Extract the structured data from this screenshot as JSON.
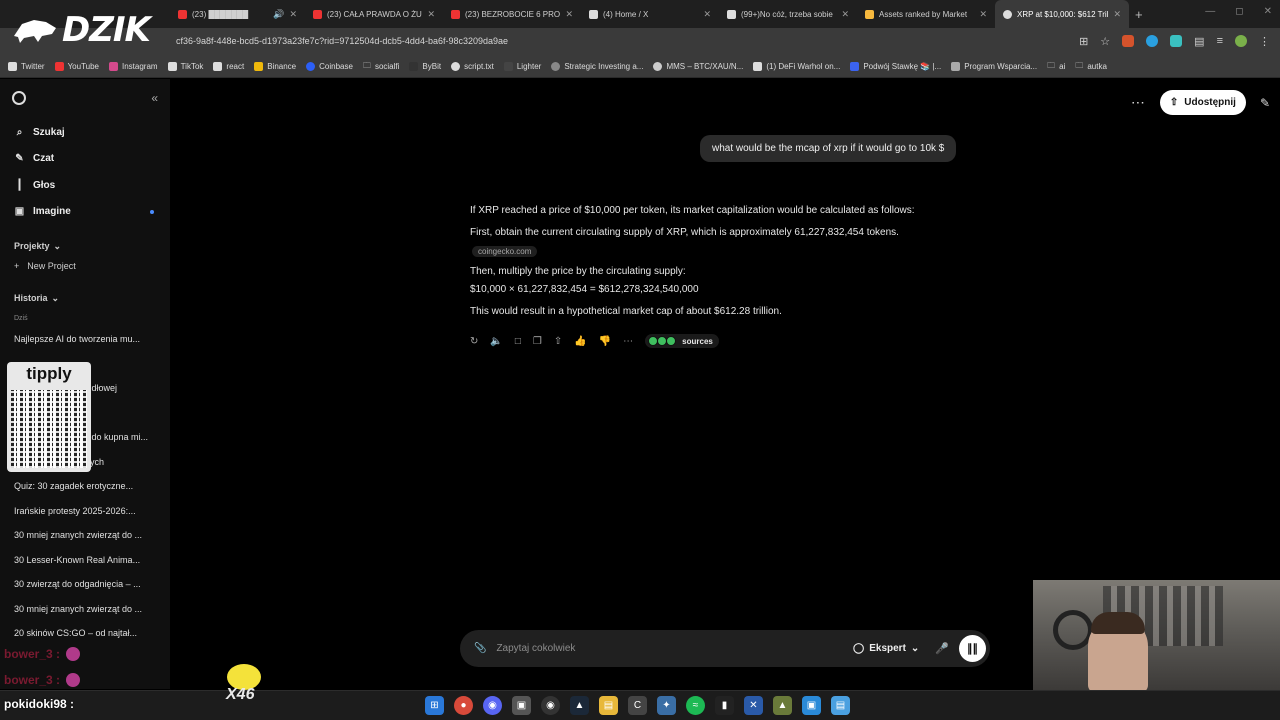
{
  "browser": {
    "tabs": [
      {
        "title": "(23) ███████",
        "color": "#e33"
      },
      {
        "title": "(23) CAŁA PRAWDA O ŻU",
        "color": "#e33"
      },
      {
        "title": "(23) BEZROBOCIE 6 PROC",
        "color": "#e33"
      },
      {
        "title": "(4) Home / X",
        "color": "#ddd"
      },
      {
        "title": "(99+)No cóż, trzeba sobie",
        "color": "#ddd"
      },
      {
        "title": "Assets ranked by Market",
        "color": "#f7b93e"
      },
      {
        "title": "XRP at $10,000: $612 Trilli",
        "color": "#ddd"
      }
    ],
    "url": "cf36-9a8f-448e-bcd5-d1973a23fe7c?rid=9712504d-dcb5-4dd4-ba6f-98c3209da9ae",
    "bookmarks": [
      {
        "label": "Twitter",
        "color": "#ddd"
      },
      {
        "label": "YouTube",
        "color": "#e33"
      },
      {
        "label": "Instagram",
        "color": "#d44a8c"
      },
      {
        "label": "TikTok",
        "color": "#ddd"
      },
      {
        "label": "react",
        "color": "#ddd"
      },
      {
        "label": "Binance",
        "color": "#f0b90b"
      },
      {
        "label": "Coinbase",
        "color": "#2c5ff6"
      },
      {
        "label": "socialfi",
        "color": "#aaa"
      },
      {
        "label": "ByBit",
        "color": "#333"
      },
      {
        "label": "script.txt",
        "color": "#ddd"
      },
      {
        "label": "Lighter",
        "color": "#444"
      },
      {
        "label": "Strategic Investing a...",
        "color": "#888"
      },
      {
        "label": "MMS – BTC/XAU/N...",
        "color": "#ccc"
      },
      {
        "label": "(1) DeFi Warhol on...",
        "color": "#ddd"
      },
      {
        "label": "Podwój Stawkę 📚 |...",
        "color": "#3b63f0"
      },
      {
        "label": "Program Wsparcia...",
        "color": "#aaa"
      },
      {
        "label": "ai",
        "color": "#aaa"
      },
      {
        "label": "autka",
        "color": "#aaa"
      }
    ]
  },
  "logo": {
    "text": "DZIK"
  },
  "sidebar": {
    "nav": [
      {
        "label": "Szukaj",
        "icon": "⌕"
      },
      {
        "label": "Czat",
        "icon": "✎"
      },
      {
        "label": "Głos",
        "icon": "┃"
      },
      {
        "label": "Imagine",
        "icon": "▣"
      }
    ],
    "projects_label": "Projekty",
    "new_project": "New Project",
    "history_label": "Historia",
    "today_label": "Dziś",
    "history": [
      "Najlepsze AI do tworzenia mu...",
      "",
      "… dłowej",
      "",
      "… do kupna mi...",
      "… ycznych",
      "Quiz: 30 zagadek erotyczne...",
      "Irańskie protesty 2025-2026:...",
      "30 mniej znanych zwierząt do ...",
      "30 Lesser-Known Real Anima...",
      "30 zwierząt do odgadnięcia – ...",
      "30 mniej znanych zwierząt do ...",
      "20 skinów CS:GO – od najtał..."
    ]
  },
  "overlays": {
    "tipply": "tipply",
    "chat": [
      {
        "name": "bower_3 :"
      },
      {
        "name": "bower_3 :"
      }
    ],
    "viewer": "pokidoki98 :",
    "counter": "X46"
  },
  "header": {
    "share_label": "Udostępnij"
  },
  "conversation": {
    "user_message": "what would be the mcap of xrp if it would go to 10k $",
    "answer": {
      "p1": "If XRP reached a price of $10,000 per token, its market capitalization would be calculated as follows:",
      "p2": "First, obtain the current circulating supply of XRP, which is approximately 61,227,832,454 tokens.",
      "source": "coingecko.com",
      "p3": "Then, multiply the price by the circulating supply:",
      "p4": "$10,000 × 61,227,832,454 = $612,278,324,540,000",
      "p5": "This would result in a hypothetical market cap of about $612.28 trillion."
    },
    "sources_label": "sources"
  },
  "composer": {
    "placeholder": "Zapytaj cokolwiek",
    "mode": "Ekspert"
  }
}
